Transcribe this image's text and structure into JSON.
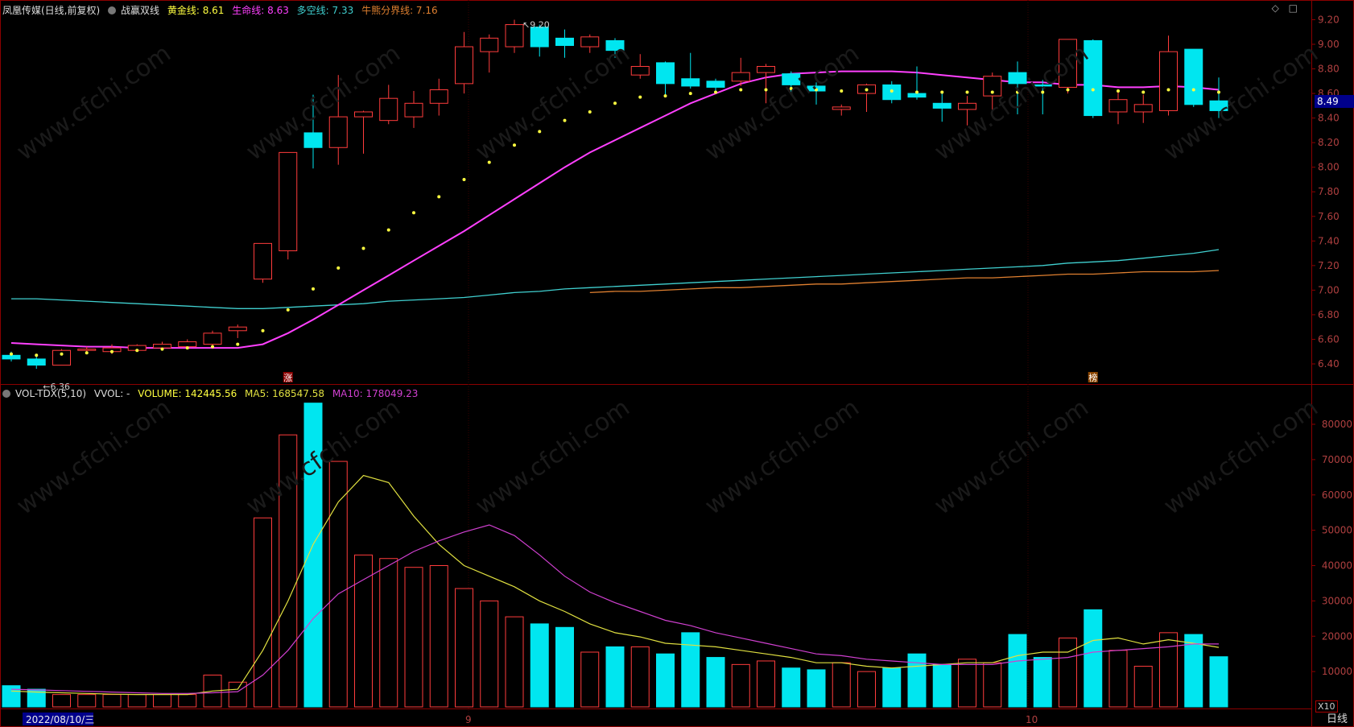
{
  "price_header": {
    "stock": "凤凰传媒(日线,前复权)",
    "indicator": "战赢双线",
    "gold_label": "黄金线: 8.61",
    "life_label": "生命线: 8.63",
    "longshort_label": "多空线: 7.33",
    "bull_label": "牛熊分界线: 7.16"
  },
  "vol_header": {
    "name": "VOL-TDX(5,10)",
    "vvol": "VVOL: -",
    "volume_label": "VOLUME: 142445.56",
    "ma5_label": "MA5: 168547.58",
    "ma10_label": "MA10: 178049.23"
  },
  "icons": [
    "diamond-icon",
    "square-icon"
  ],
  "last_price": "8.49",
  "period_label": "日线",
  "x_scale_label": "X10",
  "colors": {
    "background": "#000000",
    "up": "#ff3c3c",
    "down": "#00e6f0",
    "life": "#ff40ff",
    "gold": "#ffff40",
    "longshort": "#40d0d0",
    "bull": "#e08030",
    "grid": "#8b0000",
    "ma5": "#e0e040",
    "ma10": "#d040d0"
  },
  "chart_data": [
    {
      "type": "candlestick",
      "ylim": [
        6.3,
        9.27
      ],
      "yticks": [
        "9.20",
        "9.00",
        "8.80",
        "8.60",
        "8.40",
        "8.20",
        "8.00",
        "7.80",
        "7.60",
        "7.40",
        "7.20",
        "7.00",
        "6.80",
        "6.60",
        "6.40"
      ],
      "xlabels": [
        "2022/08/10/三",
        "9",
        "10"
      ],
      "annotations": {
        "high": "9.20",
        "low": "6.36",
        "marker_zhang": "涨",
        "marker_bang": "榜"
      },
      "candles": [
        {
          "o": 6.47,
          "h": 6.5,
          "l": 6.42,
          "c": 6.44
        },
        {
          "o": 6.44,
          "h": 6.46,
          "l": 6.36,
          "c": 6.39
        },
        {
          "o": 6.39,
          "h": 6.52,
          "l": 6.39,
          "c": 6.51
        },
        {
          "o": 6.51,
          "h": 6.54,
          "l": 6.49,
          "c": 6.52
        },
        {
          "o": 6.5,
          "h": 6.56,
          "l": 6.48,
          "c": 6.53
        },
        {
          "o": 6.51,
          "h": 6.56,
          "l": 6.5,
          "c": 6.55
        },
        {
          "o": 6.53,
          "h": 6.58,
          "l": 6.52,
          "c": 6.56
        },
        {
          "o": 6.54,
          "h": 6.6,
          "l": 6.52,
          "c": 6.58
        },
        {
          "o": 6.56,
          "h": 6.67,
          "l": 6.54,
          "c": 6.65
        },
        {
          "o": 6.67,
          "h": 6.72,
          "l": 6.61,
          "c": 6.7
        },
        {
          "o": 7.09,
          "h": 7.38,
          "l": 7.06,
          "c": 7.38
        },
        {
          "o": 7.32,
          "h": 8.12,
          "l": 7.25,
          "c": 8.12
        },
        {
          "o": 8.28,
          "h": 8.59,
          "l": 7.99,
          "c": 8.16
        },
        {
          "o": 8.16,
          "h": 8.75,
          "l": 8.02,
          "c": 8.41
        },
        {
          "o": 8.41,
          "h": 8.46,
          "l": 8.11,
          "c": 8.45
        },
        {
          "o": 8.38,
          "h": 8.67,
          "l": 8.35,
          "c": 8.56
        },
        {
          "o": 8.41,
          "h": 8.62,
          "l": 8.32,
          "c": 8.52
        },
        {
          "o": 8.52,
          "h": 8.72,
          "l": 8.42,
          "c": 8.63
        },
        {
          "o": 8.68,
          "h": 9.1,
          "l": 8.6,
          "c": 8.98
        },
        {
          "o": 8.94,
          "h": 9.08,
          "l": 8.77,
          "c": 9.05
        },
        {
          "o": 8.98,
          "h": 9.2,
          "l": 8.93,
          "c": 9.16
        },
        {
          "o": 9.14,
          "h": 9.16,
          "l": 8.9,
          "c": 8.98
        },
        {
          "o": 9.05,
          "h": 9.12,
          "l": 8.89,
          "c": 8.99
        },
        {
          "o": 8.98,
          "h": 9.08,
          "l": 8.93,
          "c": 9.06
        },
        {
          "o": 9.03,
          "h": 9.05,
          "l": 8.89,
          "c": 8.95
        },
        {
          "o": 8.75,
          "h": 8.92,
          "l": 8.72,
          "c": 8.82
        },
        {
          "o": 8.85,
          "h": 8.86,
          "l": 8.58,
          "c": 8.68
        },
        {
          "o": 8.72,
          "h": 8.93,
          "l": 8.64,
          "c": 8.66
        },
        {
          "o": 8.7,
          "h": 8.72,
          "l": 8.6,
          "c": 8.65
        },
        {
          "o": 8.7,
          "h": 8.89,
          "l": 8.66,
          "c": 8.77
        },
        {
          "o": 8.77,
          "h": 8.84,
          "l": 8.52,
          "c": 8.82
        },
        {
          "o": 8.76,
          "h": 8.78,
          "l": 8.61,
          "c": 8.67
        },
        {
          "o": 8.66,
          "h": 8.69,
          "l": 8.51,
          "c": 8.62
        },
        {
          "o": 8.47,
          "h": 8.51,
          "l": 8.42,
          "c": 8.49
        },
        {
          "o": 8.6,
          "h": 8.68,
          "l": 8.45,
          "c": 8.67
        },
        {
          "o": 8.67,
          "h": 8.7,
          "l": 8.52,
          "c": 8.55
        },
        {
          "o": 8.6,
          "h": 8.82,
          "l": 8.55,
          "c": 8.57
        },
        {
          "o": 8.52,
          "h": 8.6,
          "l": 8.37,
          "c": 8.48
        },
        {
          "o": 8.47,
          "h": 8.58,
          "l": 8.34,
          "c": 8.52
        },
        {
          "o": 8.58,
          "h": 8.77,
          "l": 8.45,
          "c": 8.74
        },
        {
          "o": 8.77,
          "h": 8.86,
          "l": 8.43,
          "c": 8.68
        },
        {
          "o": 8.67,
          "h": 8.71,
          "l": 8.43,
          "c": 8.66
        },
        {
          "o": 8.65,
          "h": 9.04,
          "l": 8.6,
          "c": 9.04
        },
        {
          "o": 9.03,
          "h": 9.04,
          "l": 8.4,
          "c": 8.42
        },
        {
          "o": 8.45,
          "h": 8.62,
          "l": 8.35,
          "c": 8.55
        },
        {
          "o": 8.45,
          "h": 8.59,
          "l": 8.36,
          "c": 8.51
        },
        {
          "o": 8.46,
          "h": 9.07,
          "l": 8.42,
          "c": 8.94
        },
        {
          "o": 8.96,
          "h": 8.96,
          "l": 8.49,
          "c": 8.51
        },
        {
          "o": 8.54,
          "h": 8.73,
          "l": 8.4,
          "c": 8.46
        }
      ],
      "series": [
        {
          "name": "生命线",
          "values": [
            6.57,
            6.56,
            6.55,
            6.54,
            6.54,
            6.53,
            6.53,
            6.53,
            6.53,
            6.53,
            6.56,
            6.65,
            6.76,
            6.88,
            7.0,
            7.12,
            7.24,
            7.36,
            7.48,
            7.61,
            7.74,
            7.87,
            8.0,
            8.12,
            8.22,
            8.32,
            8.42,
            8.52,
            8.6,
            8.68,
            8.73,
            8.76,
            8.77,
            8.78,
            8.78,
            8.78,
            8.77,
            8.75,
            8.73,
            8.71,
            8.69,
            8.69,
            8.67,
            8.67,
            8.65,
            8.65,
            8.66,
            8.65,
            8.63
          ]
        },
        {
          "name": "黄金线",
          "values": [
            6.48,
            6.47,
            6.48,
            6.49,
            6.5,
            6.51,
            6.52,
            6.53,
            6.54,
            6.56,
            6.67,
            6.84,
            7.01,
            7.18,
            7.34,
            7.49,
            7.63,
            7.76,
            7.9,
            8.04,
            8.18,
            8.29,
            8.38,
            8.45,
            8.52,
            8.57,
            8.58,
            8.6,
            8.61,
            8.63,
            8.63,
            8.64,
            8.63,
            8.62,
            8.63,
            8.62,
            8.61,
            8.61,
            8.61,
            8.61,
            8.61,
            8.61,
            8.63,
            8.63,
            8.62,
            8.61,
            8.63,
            8.63,
            8.61
          ]
        },
        {
          "name": "多空线",
          "values": [
            6.93,
            6.93,
            6.92,
            6.91,
            6.9,
            6.89,
            6.88,
            6.87,
            6.86,
            6.85,
            6.85,
            6.86,
            6.87,
            6.88,
            6.89,
            6.91,
            6.92,
            6.93,
            6.94,
            6.96,
            6.98,
            6.99,
            7.01,
            7.02,
            7.03,
            7.04,
            7.05,
            7.06,
            7.07,
            7.08,
            7.09,
            7.1,
            7.11,
            7.12,
            7.13,
            7.14,
            7.15,
            7.16,
            7.17,
            7.18,
            7.19,
            7.2,
            7.22,
            7.23,
            7.24,
            7.26,
            7.28,
            7.3,
            7.33
          ]
        },
        {
          "name": "牛熊分界线",
          "start": 23,
          "values": [
            6.98,
            6.99,
            6.99,
            7.0,
            7.01,
            7.02,
            7.02,
            7.03,
            7.04,
            7.05,
            7.05,
            7.06,
            7.07,
            7.08,
            7.09,
            7.1,
            7.1,
            7.11,
            7.12,
            7.13,
            7.13,
            7.14,
            7.15,
            7.15,
            7.15,
            7.16
          ]
        }
      ]
    },
    {
      "type": "bar",
      "ylim": [
        0,
        88000
      ],
      "yticks": [
        "80000",
        "70000",
        "60000",
        "50000",
        "40000",
        "30000",
        "20000",
        "10000"
      ],
      "volumes": [
        6000,
        5000,
        3500,
        3500,
        3500,
        3500,
        3500,
        3500,
        9000,
        7000,
        53500,
        77000,
        86000,
        69500,
        43000,
        42000,
        39500,
        40000,
        33500,
        30000,
        25500,
        23500,
        22500,
        15500,
        17000,
        17000,
        15000,
        21000,
        14000,
        12000,
        13000,
        11000,
        10500,
        12500,
        10000,
        11000,
        15000,
        12000,
        13500,
        12500,
        20500,
        14000,
        19500,
        27500,
        16000,
        11500,
        21000,
        20500,
        14200
      ],
      "series": [
        {
          "name": "MA5",
          "values": [
            4500,
            4200,
            4000,
            3800,
            3600,
            3500,
            3500,
            3500,
            4500,
            5000,
            16000,
            30000,
            46000,
            58000,
            65500,
            63500,
            54000,
            46000,
            40000,
            37000,
            34000,
            30000,
            27000,
            23500,
            21000,
            19800,
            18000,
            17500,
            17000,
            16000,
            15000,
            14000,
            12500,
            12500,
            11500,
            11000,
            11500,
            12000,
            12500,
            12500,
            14500,
            15500,
            15500,
            18800,
            19500,
            17800,
            19000,
            18000,
            16850
          ]
        },
        {
          "name": "MA10",
          "values": [
            5000,
            4800,
            4600,
            4400,
            4200,
            4000,
            3800,
            3800,
            4000,
            4300,
            9000,
            16000,
            25000,
            32000,
            36000,
            40000,
            44000,
            47000,
            49500,
            51500,
            48500,
            43000,
            37000,
            32500,
            29500,
            27000,
            24500,
            23000,
            21000,
            19500,
            18000,
            16500,
            15000,
            14500,
            13500,
            13000,
            12500,
            12000,
            12000,
            12000,
            13000,
            13500,
            14000,
            15500,
            16000,
            16500,
            17000,
            17800,
            17805
          ]
        }
      ]
    }
  ]
}
